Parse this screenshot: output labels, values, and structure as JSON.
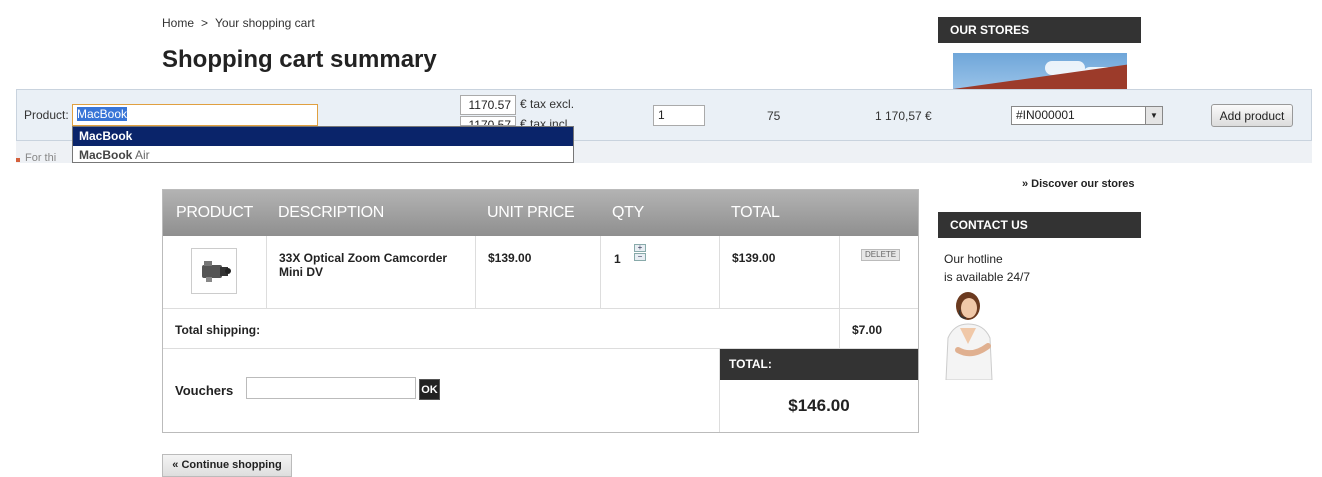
{
  "breadcrumb": {
    "home": "Home",
    "separator": ">",
    "current": "Your shopping cart"
  },
  "page_title": "Shopping cart summary",
  "admin_bar": {
    "product_label": "Product:",
    "product_value": "MacBook",
    "suggestions": [
      {
        "match": "MacBook",
        "rest": "",
        "active": true
      },
      {
        "match": "MacBook",
        "rest": " Air",
        "active": false
      }
    ],
    "price_excl": "1170.57",
    "tax_excl_label": "€ tax excl.",
    "price_incl": "1170.57",
    "tax_incl_label": "€ tax incl.",
    "quantity": "1",
    "stock": "75",
    "price_display": "1 170,57 €",
    "reference": "#IN000001",
    "add_button": "Add product",
    "strip_text": "For thi"
  },
  "cart": {
    "headers": [
      "PRODUCT",
      "DESCRIPTION",
      "UNIT PRICE",
      "QTY",
      "TOTAL"
    ],
    "items": [
      {
        "description": "33X Optical Zoom Camcorder Mini DV",
        "unit_price": "$139.00",
        "qty": "1",
        "total": "$139.00",
        "delete_label": "DELETE"
      }
    ],
    "total_shipping_label": "Total shipping:",
    "total_shipping_value": "$7.00",
    "vouchers_label": "Vouchers",
    "voucher_ok": "OK",
    "total_label": "TOTAL:",
    "total_value": "$146.00"
  },
  "continue_shopping": "« Continue shopping",
  "sidebar": {
    "stores_title": "OUR STORES",
    "discover_link": "» Discover our stores",
    "contact_title": "CONTACT US",
    "hotline_line1": "Our hotline",
    "hotline_line2": "is available 24/7"
  },
  "icons": {
    "qty_up": "plus-icon",
    "qty_down": "minus-icon",
    "select_arrow": "chevron-down-icon"
  }
}
